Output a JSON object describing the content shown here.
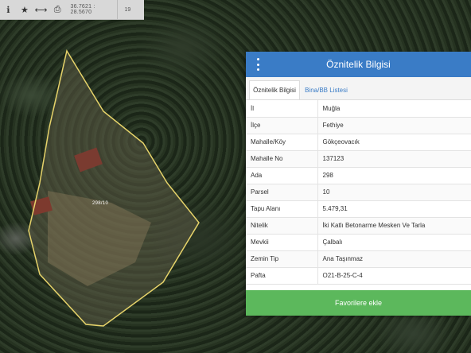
{
  "toolbar": {
    "buttons": [
      {
        "name": "info-icon",
        "glyph": "ℹ"
      },
      {
        "name": "star-icon",
        "glyph": "★"
      },
      {
        "name": "measure-icon",
        "glyph": "⟷"
      },
      {
        "name": "print-icon",
        "glyph": "⎙"
      }
    ],
    "coordinates": "36.7621 : 28.5670",
    "zoom_level": "19"
  },
  "map": {
    "parcel_label": "298/10",
    "parcel_outline_color": "#e6d36a"
  },
  "panel": {
    "title": "Öznitelik Bilgisi",
    "header_color": "#3a7cc6",
    "tabs": [
      {
        "label": "Öznitelik Bilgisi",
        "active": true
      },
      {
        "label": "Bina/BB Listesi",
        "active": false
      }
    ],
    "rows": [
      {
        "key": "İl",
        "value": "Muğla"
      },
      {
        "key": "İlçe",
        "value": "Fethiye"
      },
      {
        "key": "Mahalle/Köy",
        "value": "Gökçeovacık"
      },
      {
        "key": "Mahalle No",
        "value": "137123"
      },
      {
        "key": "Ada",
        "value": "298"
      },
      {
        "key": "Parsel",
        "value": "10"
      },
      {
        "key": "Tapu Alanı",
        "value": "5.479,31"
      },
      {
        "key": "Nitelik",
        "value": "İki Katlı Betonarme Mesken Ve Tarla"
      },
      {
        "key": "Mevkii",
        "value": "Çalbalı"
      },
      {
        "key": "Zemin Tip",
        "value": "Ana Taşınmaz"
      },
      {
        "key": "Pafta",
        "value": "O21-B-25-C-4"
      }
    ],
    "favorite_button_label": "Favorilere ekle",
    "favorite_button_color": "#5cb85c"
  }
}
